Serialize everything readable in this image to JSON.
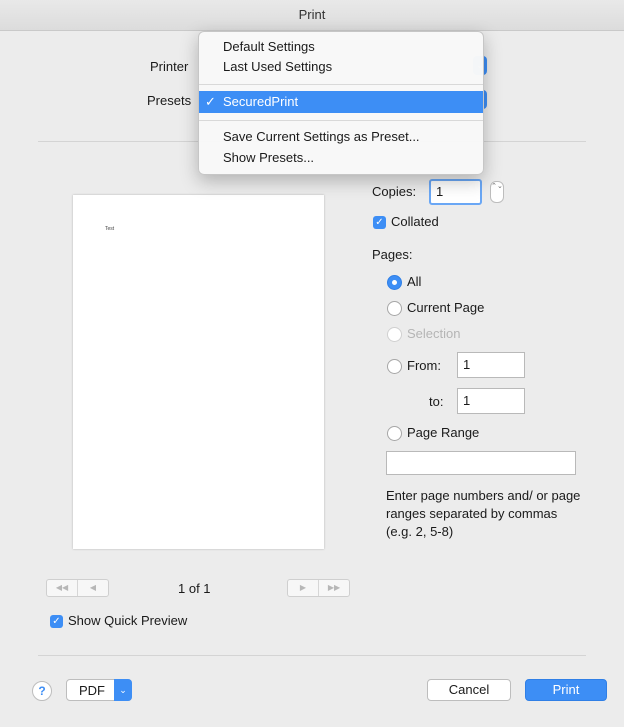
{
  "window": {
    "title": "Print"
  },
  "form": {
    "printer_label": "Printer",
    "presets_label": "Presets"
  },
  "presets_menu": {
    "items": [
      "Default Settings",
      "Last Used Settings",
      "SecuredPrint",
      "Save Current Settings as Preset...",
      "Show Presets..."
    ],
    "selected": "SecuredPrint"
  },
  "preview": {
    "page_text": "Test ",
    "page_indicator": "1 of 1",
    "show_quick_preview_label": "Show Quick Preview",
    "show_quick_preview": true
  },
  "copies": {
    "label": "Copies:",
    "value": "1",
    "collated_label": "Collated",
    "collated": true
  },
  "pages": {
    "label": "Pages:",
    "options": [
      "All",
      "Current Page",
      "Selection",
      "From:",
      "Page Range"
    ],
    "selected": "All",
    "from_value": "1",
    "to_label": "to:",
    "to_value": "1",
    "range_value": "",
    "help_text": "Enter page numbers and/ or page ranges separated by commas (e.g. 2, 5-8)"
  },
  "footer": {
    "help_label": "?",
    "pdf_label": "PDF",
    "cancel_label": "Cancel",
    "print_label": "Print"
  },
  "icons": {
    "checkmark": "✓",
    "chevron_down": "⌄",
    "select_arrows": "⌃⌄",
    "nav_first": "◀◀",
    "nav_prev": "◀",
    "nav_next": "▶",
    "nav_last": "▶▶"
  },
  "colors": {
    "accent": "#3d8ef5",
    "background": "#ececec"
  }
}
